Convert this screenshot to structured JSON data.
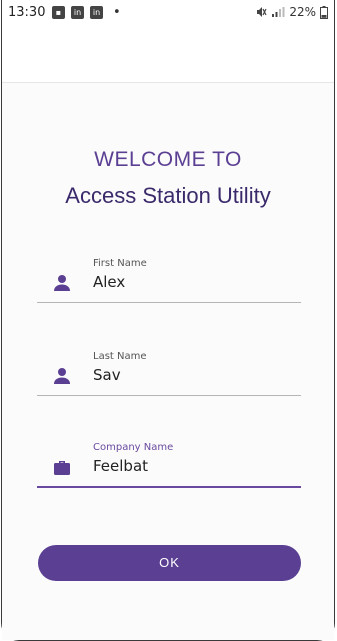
{
  "status_bar": {
    "time": "13:30",
    "battery": "22%",
    "notification_icons": [
      "message-icon",
      "linkedin-icon",
      "linkedin-icon"
    ],
    "dot": "•"
  },
  "welcome": {
    "line1": "WELCOME TO",
    "line2": "Access Station Utility"
  },
  "form": {
    "first_name": {
      "label": "First Name",
      "value": "Alex",
      "icon": "person-icon"
    },
    "last_name": {
      "label": "Last Name",
      "value": "Sav",
      "icon": "person-icon"
    },
    "company_name": {
      "label": "Company Name",
      "value": "Feelbat",
      "icon": "briefcase-icon"
    }
  },
  "actions": {
    "ok_label": "OK"
  },
  "colors": {
    "accent": "#5b3f93",
    "title": "#3b2a6b",
    "active_underline": "#6a4aa0"
  }
}
